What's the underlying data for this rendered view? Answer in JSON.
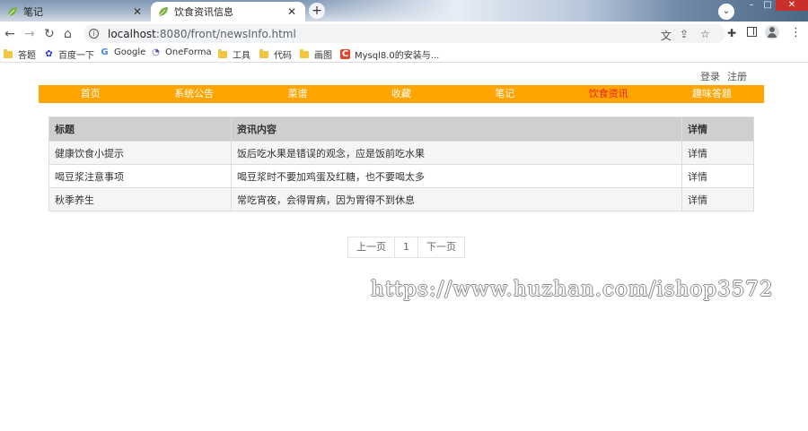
{
  "browser": {
    "tabs": [
      {
        "title": "笔记"
      },
      {
        "title": "饮食资讯信息"
      }
    ],
    "url_host": "localhost",
    "url_path": ":8080/front/newsInfo.html",
    "bookmarks": [
      "答题",
      "百度一下",
      "Google",
      "OneForma",
      "工具",
      "代码",
      "画图",
      "Mysql8.0的安装与..."
    ]
  },
  "header": {
    "login": "登录",
    "register": "注册"
  },
  "nav": {
    "items": [
      "首页",
      "系统公告",
      "菜谱",
      "收藏",
      "笔记",
      "饮食资讯",
      "趣味答题"
    ],
    "active": "饮食资讯"
  },
  "table": {
    "headers": [
      "标题",
      "资讯内容",
      "详情"
    ],
    "rows": [
      [
        "健康饮食小提示",
        "饭后吃水果是错误的观念，应是饭前吃水果",
        "详情"
      ],
      [
        "喝豆浆注意事项",
        "喝豆浆时不要加鸡蛋及红糖，也不要喝太多",
        "详情"
      ],
      [
        "秋季养生",
        "常吃宵夜，会得胃病，因为胃得不到休息",
        "详情"
      ]
    ]
  },
  "pager": {
    "prev": "上一页",
    "page": "1",
    "next": "下一页"
  },
  "watermark": "https://www.huzhan.com/ishop3572",
  "colors": {
    "nav_bg": "#ffa400",
    "nav_active": "#e81e1e",
    "table_header_bg": "#cfcfcf"
  }
}
